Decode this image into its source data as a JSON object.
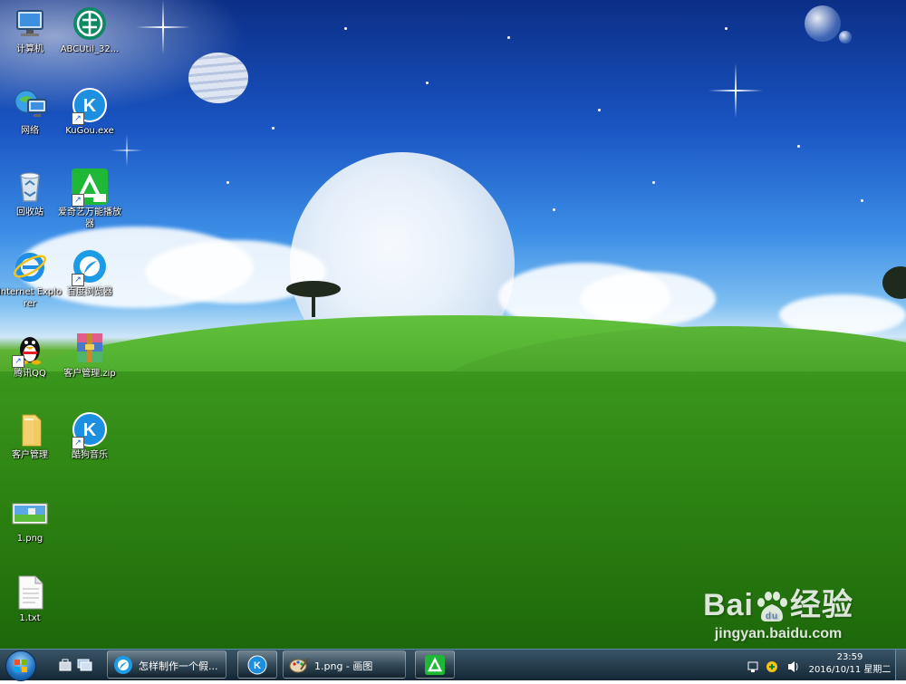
{
  "desktop_icons": [
    {
      "label": "计算机",
      "icon": "computer-icon"
    },
    {
      "label": "ABCUtil_32...",
      "icon": "abc-bank-icon"
    },
    {
      "label": "网络",
      "icon": "network-icon"
    },
    {
      "label": "KuGou.exe",
      "icon": "kugou-icon"
    },
    {
      "label": "回收站",
      "icon": "recycle-bin-icon"
    },
    {
      "label": "爱奇艺万能播放器",
      "icon": "iqiyi-player-icon"
    },
    {
      "label": "Internet Explorer",
      "icon": "internet-explorer-icon"
    },
    {
      "label": "百度浏览器",
      "icon": "baidu-browser-icon"
    },
    {
      "label": "腾讯QQ",
      "icon": "qq-penguin-icon"
    },
    {
      "label": "客户管理.zip",
      "icon": "winrar-archive-icon"
    },
    {
      "label": "客户管理",
      "icon": "folder-icon"
    },
    {
      "label": "酷狗音乐",
      "icon": "kugou-icon"
    },
    {
      "label": "1.png",
      "icon": "image-file-icon"
    },
    {
      "label": "1.txt",
      "icon": "text-file-icon"
    }
  ],
  "watermark": {
    "brand_left": "Bai",
    "brand_right": "经验",
    "url": "jingyan.baidu.com"
  },
  "taskbar": {
    "start_icon": "windows-start-orb",
    "buttons": [
      {
        "label": "怎样制作一个假...",
        "icon": "baidu-browser-icon"
      },
      {
        "label": "",
        "icon": "kugou-icon"
      },
      {
        "label": "1.png - 画图",
        "icon": "paint-icon"
      },
      {
        "label": "",
        "icon": "iqiyi-player-icon"
      }
    ],
    "clock": {
      "time": "23:59",
      "date": "2016/10/11 星期二"
    }
  },
  "colors": {
    "taskbar": "#17324a",
    "sky_top": "#0b2e86",
    "grass": "#2c8412",
    "kugou_blue": "#1d8fe0",
    "iqiyi_green": "#1fb736"
  }
}
